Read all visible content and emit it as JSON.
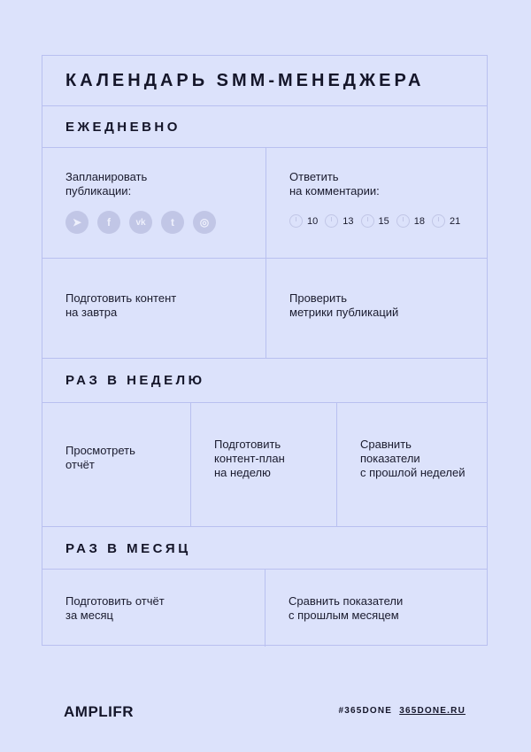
{
  "title": "КАЛЕНДАРЬ SMM-МЕНЕДЖЕРА",
  "daily": {
    "heading": "ЕЖЕДНЕВНО",
    "schedule": {
      "text": "Запланировать\nпубликации:",
      "icons": [
        "telegram-icon",
        "facebook-icon",
        "vk-icon",
        "twitter-icon",
        "instagram-icon"
      ],
      "icon_glyphs": [
        "➤",
        "f",
        "vk",
        "t",
        "◎"
      ]
    },
    "reply": {
      "text": "Ответить\nна комментарии:",
      "times": [
        "10",
        "13",
        "15",
        "18",
        "21"
      ]
    },
    "prepare": {
      "text": "Подготовить контент\nна завтра"
    },
    "metrics": {
      "text": "Проверить\nметрики публикаций"
    }
  },
  "weekly": {
    "heading": "РАЗ В НЕДЕЛЮ",
    "cells": [
      {
        "text": "Просмотреть\nотчёт"
      },
      {
        "text": "Подготовить\nконтент-план\nна неделю"
      },
      {
        "text": "Сравнить\nпоказатели\nс прошлой неделей"
      }
    ]
  },
  "monthly": {
    "heading": "РАЗ В МЕСЯЦ",
    "cells": [
      {
        "text": "Подготовить отчёт\nза месяц"
      },
      {
        "text": "Сравнить показатели\nс прошлым месяцем"
      }
    ]
  },
  "footer": {
    "logo": "AMPLIFR",
    "hashtag": "#365DONE",
    "url": "365DONE.RU"
  },
  "colors": {
    "background": "#dce2fb",
    "lines": "#b9c0f0",
    "icons": "#c1c6e6",
    "text": "#15162a"
  }
}
